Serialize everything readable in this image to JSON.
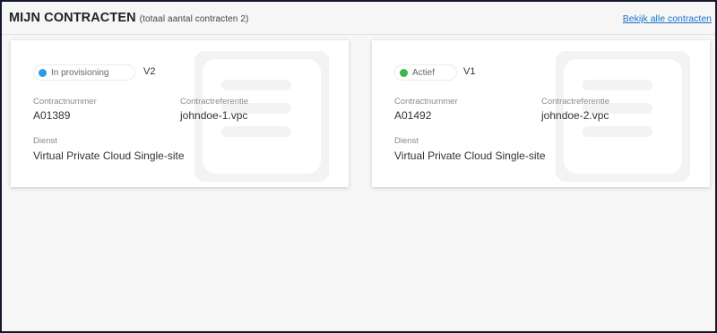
{
  "header": {
    "title": "MIJN CONTRACTEN",
    "subtitle": "(totaal aantal contracten 2)",
    "view_all_label": "Bekijk alle contracten"
  },
  "labels": {
    "contract_number": "Contractnummer",
    "contract_reference": "Contractreferentie",
    "service": "Dienst"
  },
  "contracts": [
    {
      "status": "In provisioning",
      "status_color": "#2e9be6",
      "version": "V2",
      "contract_number": "A01389",
      "contract_reference": "johndoe-1.vpc",
      "service": "Virtual Private Cloud Single-site"
    },
    {
      "status": "Actief",
      "status_color": "#3cb54a",
      "version": "V1",
      "contract_number": "A01492",
      "contract_reference": "johndoe-2.vpc",
      "service": "Virtual Private Cloud Single-site"
    }
  ]
}
